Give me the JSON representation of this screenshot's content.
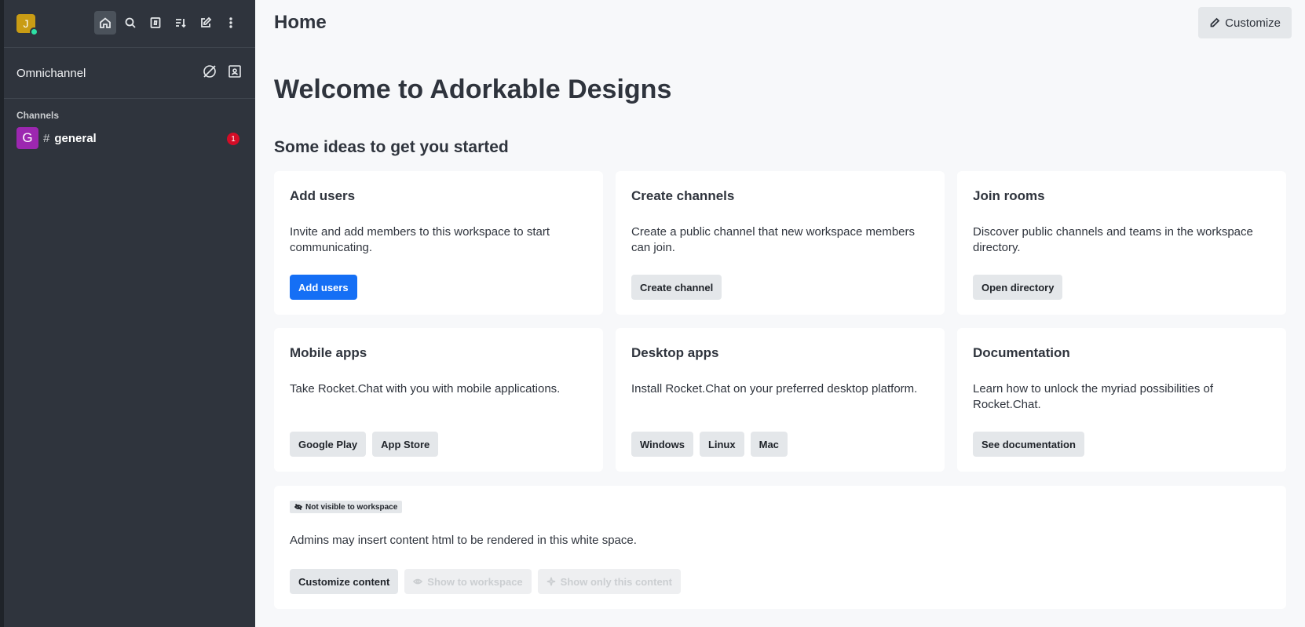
{
  "sidebar": {
    "avatar_initial": "J",
    "omnichannel_label": "Omnichannel",
    "section_title": "Channels",
    "rooms": [
      {
        "initial": "G",
        "prefix": "#",
        "name": "general",
        "unread": "1"
      }
    ]
  },
  "header": {
    "title": "Home",
    "customize_label": "Customize"
  },
  "main": {
    "welcome": "Welcome to Adorkable Designs",
    "ideas_title": "Some ideas to get you started",
    "cards": [
      {
        "title": "Add users",
        "desc": "Invite and add members to this workspace to start communicating.",
        "buttons": [
          "Add users"
        ]
      },
      {
        "title": "Create channels",
        "desc": "Create a public channel that new workspace members can join.",
        "buttons": [
          "Create channel"
        ]
      },
      {
        "title": "Join rooms",
        "desc": "Discover public channels and teams in the workspace directory.",
        "buttons": [
          "Open directory"
        ]
      },
      {
        "title": "Mobile apps",
        "desc": "Take Rocket.Chat with you with mobile applications.",
        "buttons": [
          "Google Play",
          "App Store"
        ]
      },
      {
        "title": "Desktop apps",
        "desc": "Install Rocket.Chat on your preferred desktop platform.",
        "buttons": [
          "Windows",
          "Linux",
          "Mac"
        ]
      },
      {
        "title": "Documentation",
        "desc": "Learn how to unlock the myriad possibilities of Rocket.Chat.",
        "buttons": [
          "See documentation"
        ]
      }
    ],
    "admin_box": {
      "tag": "Not visible to workspace",
      "text": "Admins may insert content html to be rendered in this white space.",
      "buttons": [
        "Customize content",
        "Show to workspace",
        "Show only this content"
      ]
    }
  },
  "colors": {
    "sidebar_bg": "#2f343d",
    "primary": "#156ff5",
    "avatar_user": "#c99c14",
    "avatar_room": "#9c27b0",
    "badge": "#d40c26",
    "status_online": "#2de0a5"
  }
}
